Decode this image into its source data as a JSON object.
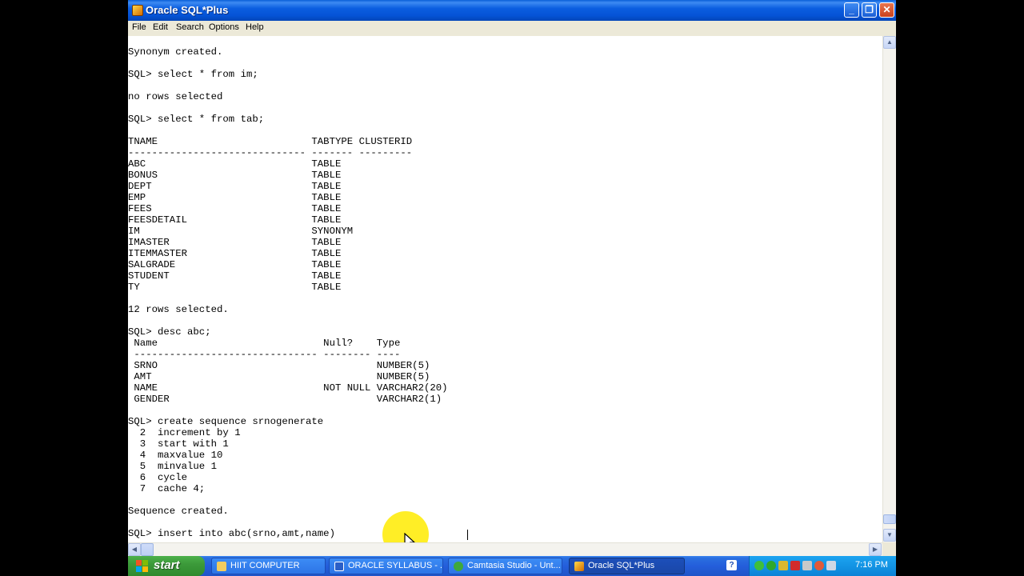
{
  "window": {
    "title": "Oracle SQL*Plus",
    "menu": [
      "File",
      "Edit",
      "Search",
      "Options",
      "Help"
    ]
  },
  "console": {
    "lines": [
      "Synonym created.",
      "",
      "SQL> select * from im;",
      "",
      "no rows selected",
      "",
      "SQL> select * from tab;",
      "",
      "TNAME                          TABTYPE CLUSTERID",
      "------------------------------ ------- ---------",
      "ABC                            TABLE",
      "BONUS                          TABLE",
      "DEPT                           TABLE",
      "EMP                            TABLE",
      "FEES                           TABLE",
      "FEESDETAIL                     TABLE",
      "IM                             SYNONYM",
      "IMASTER                        TABLE",
      "ITEMMASTER                     TABLE",
      "SALGRADE                       TABLE",
      "STUDENT                        TABLE",
      "TY                             TABLE",
      "",
      "12 rows selected.",
      "",
      "SQL> desc abc;",
      " Name                            Null?    Type",
      " ------------------------------- -------- ----",
      " SRNO                                     NUMBER(5)",
      " AMT                                      NUMBER(5)",
      " NAME                            NOT NULL VARCHAR2(20)",
      " GENDER                                   VARCHAR2(1)",
      "",
      "SQL> create sequence srnogenerate",
      "  2  increment by 1",
      "  3  start with 1",
      "  4  maxvalue 10",
      "  5  minvalue 1",
      "  6  cycle",
      "  7  cache 4;",
      "",
      "Sequence created.",
      "",
      "SQL> insert into abc(srno,amt,name)"
    ]
  },
  "taskbar": {
    "start_label": "start",
    "tasks": [
      {
        "label": "HIIT COMPUTER",
        "icon": "folder-icon"
      },
      {
        "label": "ORACLE SYLLABUS - ...",
        "icon": "word-document-icon"
      },
      {
        "label": "Camtasia Studio - Unt...",
        "icon": "camtasia-icon"
      },
      {
        "label": "Oracle SQL*Plus",
        "icon": "sqlplus-icon",
        "active": true
      }
    ],
    "help_glyph": "?",
    "clock": "7:16 PM"
  },
  "colors": {
    "titlebar": "#0553d6",
    "taskbar": "#245edb",
    "start": "#3c9a3a",
    "tray": "#1394e4",
    "pointer_highlight": "#ffeb00"
  }
}
